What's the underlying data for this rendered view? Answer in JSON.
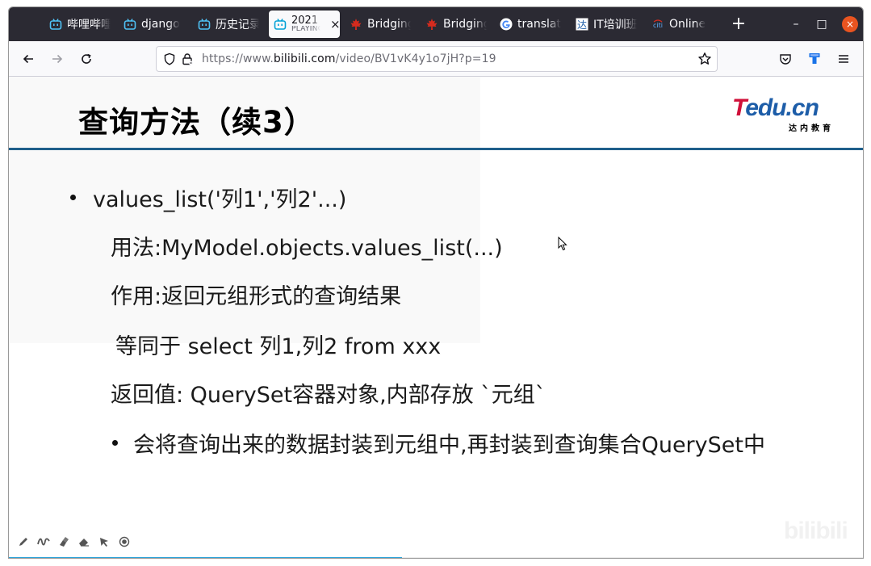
{
  "browser": {
    "tabs": [
      {
        "label": "哔哩哔哩",
        "icon": "bilibili-icon",
        "active": false
      },
      {
        "label": "django",
        "icon": "bilibili-icon",
        "active": false
      },
      {
        "label": "历史记录",
        "icon": "bilibili-icon",
        "active": false
      },
      {
        "label": "2021",
        "sublabel": "PLAYING",
        "icon": "bilibili-icon",
        "active": true,
        "close": "×"
      },
      {
        "label": "Bridging",
        "icon": "maple-leaf-icon",
        "active": false
      },
      {
        "label": "Bridging",
        "icon": "maple-leaf-icon",
        "active": false
      },
      {
        "label": "translate",
        "icon": "google-icon",
        "active": false
      },
      {
        "label": "IT培训班",
        "icon": "tarena-icon",
        "active": false
      },
      {
        "label": "Online",
        "icon": "citi-icon",
        "active": false
      }
    ],
    "new_tab": "+",
    "window_controls": {
      "minimize": "–",
      "maximize": "□",
      "close": "×"
    },
    "url": {
      "prefix": "https://www.",
      "domain": "bilibili.com",
      "path": "/video/BV1vK4y1o7jH?p=19"
    }
  },
  "slide": {
    "title": "查询方法（续3）",
    "logo": {
      "main_t": "T",
      "main_rest": "edu.cn",
      "sub": "达内教育"
    },
    "lines": [
      "values_list('列1','列2'...)",
      "用法:MyModel.objects.values_list(...)",
      "作用:返回元组形式的查询结果",
      "等同于 select 列1,列2 from xxx",
      "返回值: QuerySet容器对象,内部存放 `元组`",
      "会将查询出来的数据封装到元组中,再封装到查询集合QuerySet中"
    ]
  },
  "player": {
    "tools": [
      "pen-icon",
      "squiggle-icon",
      "highlighter-icon",
      "eraser-icon",
      "pointer-icon",
      "record-icon"
    ],
    "watermark": "bilibili",
    "progress": 0.46
  },
  "colors": {
    "tabbar_bg": "#2b2a33",
    "title_rule": "#1f5f8b",
    "bilibili_blue": "#00a1d6",
    "progress": "#2aa3d9",
    "close_btn": "#e95420"
  }
}
